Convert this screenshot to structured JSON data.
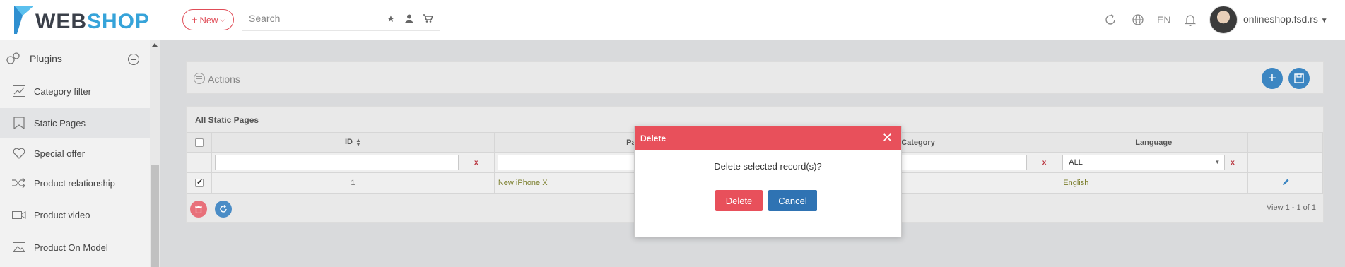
{
  "app": {
    "logo_web": "WEB",
    "logo_shop": "SHOP",
    "new_label": "New",
    "search_placeholder": "Search",
    "language": "EN",
    "user": "onlineshop.fsd.rs"
  },
  "sidebar": {
    "plugins_label": "Plugins",
    "items": [
      {
        "label": "Category filter",
        "icon": "chart-icon"
      },
      {
        "label": "Static Pages",
        "icon": "bookmark-page-icon",
        "active": true
      },
      {
        "label": "Special offer",
        "icon": "heart-icon"
      },
      {
        "label": "Product relationship",
        "icon": "shuffle-icon"
      },
      {
        "label": "Product video",
        "icon": "video-icon"
      },
      {
        "label": "Product On Model",
        "icon": "image-icon"
      }
    ]
  },
  "actions": {
    "label": "Actions"
  },
  "grid": {
    "title": "All Static Pages",
    "columns": [
      "ID",
      "Page",
      "Category",
      "Language"
    ],
    "filters": {
      "language_selected": "ALL",
      "clear_symbol": "x"
    },
    "rows": [
      {
        "checked": true,
        "id": "1",
        "page": "New iPhone X",
        "category": "",
        "language": "English"
      }
    ],
    "view_info": "View 1 - 1 of 1"
  },
  "modal": {
    "title": "Delete",
    "message": "Delete selected record(s)?",
    "confirm_label": "Delete",
    "cancel_label": "Cancel"
  },
  "colors": {
    "accent_red": "#e8505b",
    "accent_blue": "#3c86c2",
    "logo_blue": "#36a3d9"
  }
}
